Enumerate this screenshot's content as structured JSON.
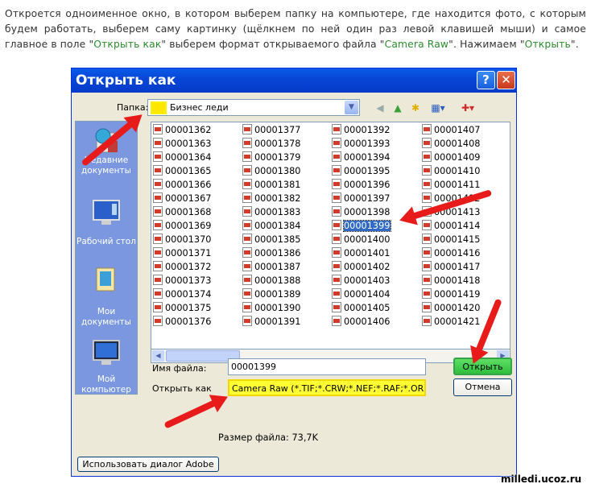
{
  "intro": {
    "text_a": "Откроется одноименное окно, в котором выберем папку на компьютере, где находится фото, с которым будем работать, выберем саму картинку (щёлкнем по ней один раз левой клавишей мыши) и самое главное в поле \"",
    "hl_a": "Открыть как",
    "text_b": "\" выберем формат открываемого файла \"",
    "hl_b": "Camera Raw",
    "text_c": "\". Нажимаем \"",
    "hl_c": "Открыть",
    "text_d": "\"."
  },
  "dialog": {
    "title": "Открыть как",
    "help_label": "?",
    "close_label": "✕",
    "folder_label": "Папка:",
    "folder_value": "Бизнес леди",
    "places": [
      {
        "label": "Недавние документы"
      },
      {
        "label": "Рабочий стол"
      },
      {
        "label": "Мои документы"
      },
      {
        "label": "Мой компьютер"
      }
    ],
    "files": [
      "00001362",
      "00001363",
      "00001364",
      "00001365",
      "00001366",
      "00001367",
      "00001368",
      "00001369",
      "00001370",
      "00001371",
      "00001372",
      "00001373",
      "00001374",
      "00001375",
      "00001376",
      "00001377",
      "00001378",
      "00001379",
      "00001380",
      "00001381",
      "00001382",
      "00001383",
      "00001384",
      "00001385",
      "00001386",
      "00001387",
      "00001388",
      "00001389",
      "00001390",
      "00001391",
      "00001392",
      "00001393",
      "00001394",
      "00001395",
      "00001396",
      "00001397",
      "00001398",
      "00001399",
      "00001400",
      "00001401",
      "00001402",
      "00001403",
      "00001404",
      "00001405",
      "00001406",
      "00001407",
      "00001408",
      "00001409",
      "00001410",
      "00001411",
      "00001412",
      "00001413",
      "00001414",
      "00001415",
      "00001416",
      "00001417",
      "00001418",
      "00001419",
      "00001420",
      "00001421"
    ],
    "selected_file": "00001399",
    "filename_label": "Имя файла:",
    "filename_value": "00001399",
    "filetype_label": "Открыть как",
    "filetype_value": "Camera Raw (*.TIF;*.CRW;*.NEF;*.RAF;*.ORF",
    "open_label": "Открыть",
    "cancel_label": "Отмена",
    "filesize_text": "Размер файла: 73,7K",
    "adobe_dialog_label": "Использовать диалог Adobe"
  },
  "colors": {
    "highlight_text": "#2e8a2e",
    "title_bar": "#0745d6",
    "selection": "#316ac5",
    "annotation_arrow": "#e81b1b"
  },
  "watermark": "milledi.ucoz.ru"
}
